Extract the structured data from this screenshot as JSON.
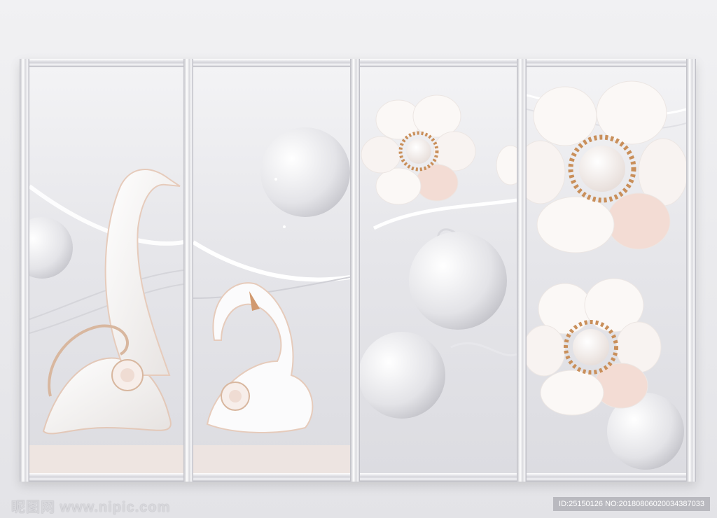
{
  "image": {
    "subject": "3D wall mural with white porcelain swans, pearl flowers and spheres in a four-panel window frame",
    "colors": {
      "background": "#eeeef1",
      "frame": "#d9d9de",
      "pearl": "#f6f1ee",
      "gold": "#c98f5a",
      "blush": "#f1d6cf"
    }
  },
  "watermark": {
    "left": "昵图网 www.nipic.com",
    "right": "ID:25150126 NO:20180806020034387033"
  }
}
